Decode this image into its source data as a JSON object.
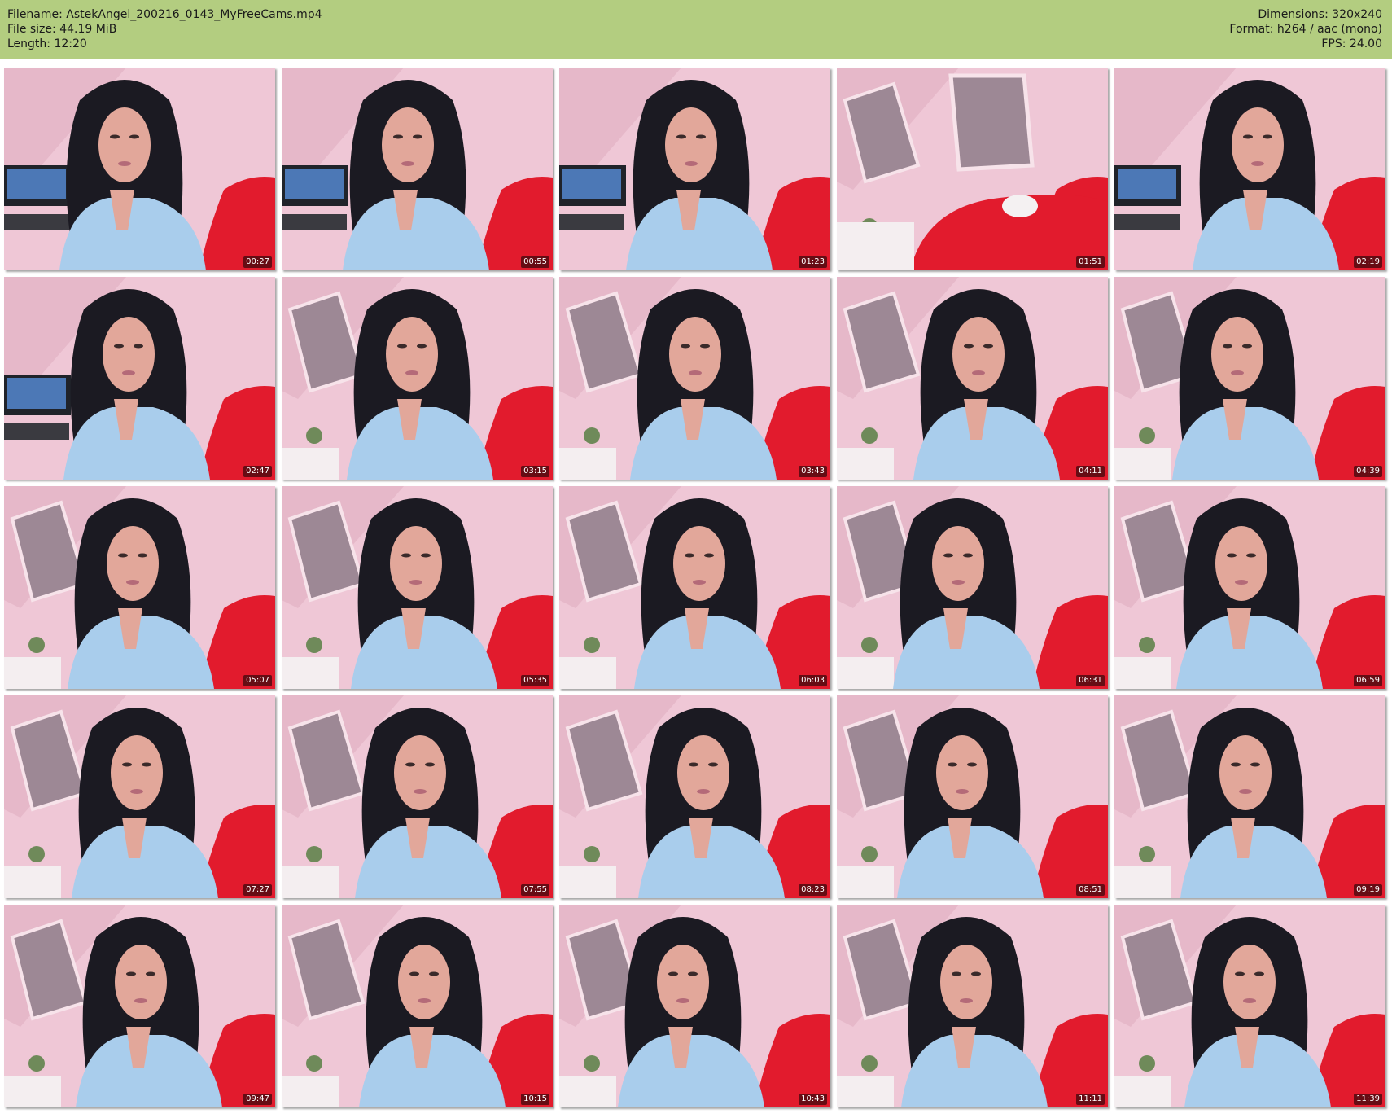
{
  "header": {
    "filename": "Filename: AstekAngel_200216_0143_MyFreeCams.mp4",
    "filesize": "File size: 44.19 MiB",
    "length": "Length: 12:20",
    "dimensions": "Dimensions: 320x240",
    "format": "Format: h264 / aac (mono)",
    "fps": "FPS: 24.00"
  },
  "colors": {
    "header_bg": "#b3cd80",
    "wall": "#efc7d6",
    "window": "#9d8895",
    "hair": "#1b1a22",
    "skin": "#e2a79a",
    "shirt": "#a9cdec",
    "sofa": "#e21b2d"
  },
  "frames": [
    {
      "timestamp": "00:27",
      "variant": "tv"
    },
    {
      "timestamp": "00:55",
      "variant": "tv"
    },
    {
      "timestamp": "01:23",
      "variant": "tv"
    },
    {
      "timestamp": "01:51",
      "variant": "room"
    },
    {
      "timestamp": "02:19",
      "variant": "tv"
    },
    {
      "timestamp": "02:47",
      "variant": "tv"
    },
    {
      "timestamp": "03:15",
      "variant": "window"
    },
    {
      "timestamp": "03:43",
      "variant": "window"
    },
    {
      "timestamp": "04:11",
      "variant": "window"
    },
    {
      "timestamp": "04:39",
      "variant": "window"
    },
    {
      "timestamp": "05:07",
      "variant": "window"
    },
    {
      "timestamp": "05:35",
      "variant": "window"
    },
    {
      "timestamp": "06:03",
      "variant": "window"
    },
    {
      "timestamp": "06:31",
      "variant": "window"
    },
    {
      "timestamp": "06:59",
      "variant": "window"
    },
    {
      "timestamp": "07:27",
      "variant": "window"
    },
    {
      "timestamp": "07:55",
      "variant": "window"
    },
    {
      "timestamp": "08:23",
      "variant": "window"
    },
    {
      "timestamp": "08:51",
      "variant": "window"
    },
    {
      "timestamp": "09:19",
      "variant": "window"
    },
    {
      "timestamp": "09:47",
      "variant": "window"
    },
    {
      "timestamp": "10:15",
      "variant": "window"
    },
    {
      "timestamp": "10:43",
      "variant": "window"
    },
    {
      "timestamp": "11:11",
      "variant": "window"
    },
    {
      "timestamp": "11:39",
      "variant": "window"
    }
  ]
}
